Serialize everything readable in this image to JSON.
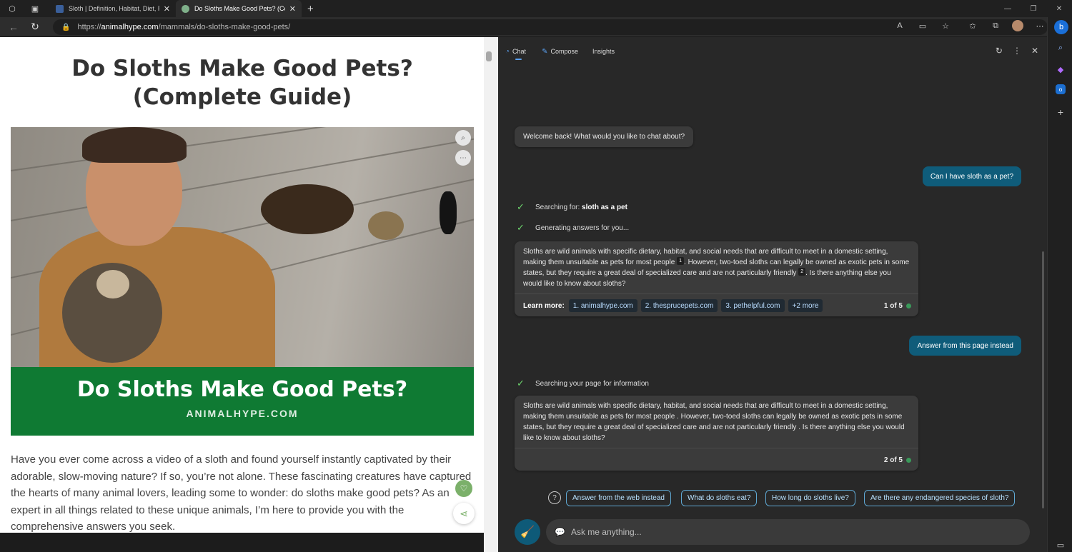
{
  "browser": {
    "tabs": [
      {
        "title": "Sloth | Definition, Habitat, Diet, F",
        "fav_color": "#3a5f9a"
      },
      {
        "title": "Do Sloths Make Good Pets? (Co",
        "fav_color": "#7fb08a"
      }
    ],
    "url_prefix": "https://",
    "url_host": "animalhype.com",
    "url_path": "/mammals/do-sloths-make-good-pets/"
  },
  "page": {
    "title": "Do Sloths Make Good Pets? (Complete Guide)",
    "banner_title": "Do Sloths Make Good Pets?",
    "banner_site": "ANIMALHYPE.COM",
    "article": "Have you ever come across a video of a sloth and found yourself instantly captivated by their adorable, slow-moving nature? If so, you’re not alone. These fascinating creatures have captured the hearts of many animal lovers, leading some to wonder: do sloths make good pets? As an expert in all things related to these unique animals, I’m here to provide you with the comprehensive answers you seek."
  },
  "sidebar": {
    "tabs": [
      "Chat",
      "Compose",
      "Insights"
    ],
    "welcome": "Welcome back! What would you like to chat about?",
    "user_msg_1": "Can I have sloth as a pet?",
    "search_status_prefix": "Searching for: ",
    "search_query": "sloth as a pet",
    "generating_status": "Generating answers for you...",
    "answer1": {
      "p1": "Sloths are wild animals with specific dietary, habitat, and social needs that are difficult to meet in a domestic setting, making them unsuitable as pets for most people ",
      "cite1": "1",
      "p2": ". However, two-toed sloths can legally be owned as exotic pets in some states, but they require a great deal of specialized care and are not particularly friendly ",
      "cite2": "2",
      "p3": ". Is there anything else you would like to know about sloths?"
    },
    "learn_more_label": "Learn more:",
    "sources": [
      "1. animalhype.com",
      "2. thesprucepets.com",
      "3. pethelpful.com",
      "+2 more"
    ],
    "count1": "1 of 5",
    "user_msg_2": "Answer from this page instead",
    "page_search_status": "Searching your page for information",
    "answer2": "Sloths are wild animals with specific dietary, habitat, and social needs that are difficult to meet in a domestic setting, making them unsuitable as pets for most people . However, two-toed sloths can legally be owned as exotic pets in some states, but they require a great deal of specialized care and are not particularly friendly . Is there anything else you would like to know about sloths?",
    "count2": "2 of 5",
    "suggestions": [
      "Answer from the web instead",
      "What do sloths eat?",
      "How long do sloths live?",
      "Are there any endangered species of sloth?"
    ],
    "ask_placeholder": "Ask me anything..."
  },
  "colors": {
    "accent": "#0f5c7a",
    "banner_green": "#0f7a33",
    "source_chip": "#b9dcff"
  }
}
